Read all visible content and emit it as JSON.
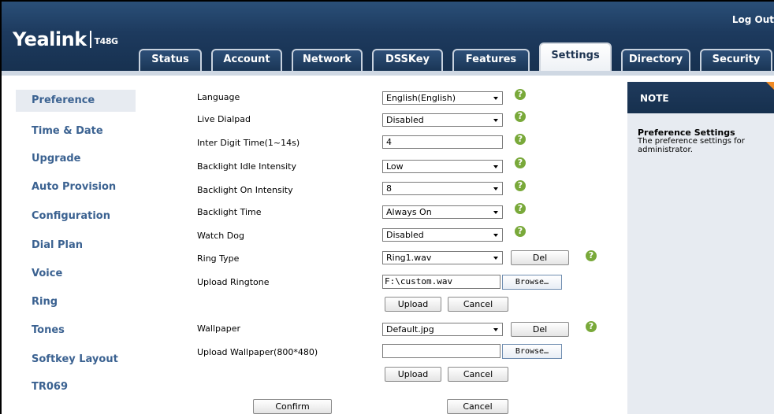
{
  "header": {
    "logo_brand": "Yealink",
    "logo_model": "T48G",
    "logout": "Log Out"
  },
  "tabs": [
    {
      "label": "Status"
    },
    {
      "label": "Account"
    },
    {
      "label": "Network"
    },
    {
      "label": "DSSKey"
    },
    {
      "label": "Features"
    },
    {
      "label": "Settings"
    },
    {
      "label": "Directory"
    },
    {
      "label": "Security"
    }
  ],
  "active_tab": "Settings",
  "sidebar": {
    "items": [
      {
        "label": "Preference"
      },
      {
        "label": "Time & Date"
      },
      {
        "label": "Upgrade"
      },
      {
        "label": "Auto Provision"
      },
      {
        "label": "Configuration"
      },
      {
        "label": "Dial Plan"
      },
      {
        "label": "Voice"
      },
      {
        "label": "Ring"
      },
      {
        "label": "Tones"
      },
      {
        "label": "Softkey Layout"
      },
      {
        "label": "TR069"
      }
    ],
    "active": "Preference"
  },
  "form": {
    "language": {
      "label": "Language",
      "value": "English(English)"
    },
    "live_dialpad": {
      "label": "Live Dialpad",
      "value": "Disabled"
    },
    "inter_digit": {
      "label": "Inter Digit Time(1~14s)",
      "value": "4"
    },
    "backlight_idle": {
      "label": "Backlight Idle Intensity",
      "value": "Low"
    },
    "backlight_on": {
      "label": "Backlight On Intensity",
      "value": "8"
    },
    "backlight_time": {
      "label": "Backlight Time",
      "value": "Always On"
    },
    "watch_dog": {
      "label": "Watch Dog",
      "value": "Disabled"
    },
    "ring_type": {
      "label": "Ring Type",
      "value": "Ring1.wav",
      "del": "Del"
    },
    "upload_ringtone": {
      "label": "Upload Ringtone",
      "file": "F:\\custom.wav",
      "browse": "Browse…",
      "upload": "Upload",
      "cancel": "Cancel"
    },
    "wallpaper": {
      "label": "Wallpaper",
      "value": "Default.jpg",
      "del": "Del"
    },
    "upload_wallpaper": {
      "label": "Upload Wallpaper(800*480)",
      "file": "",
      "browse": "Browse…",
      "upload": "Upload",
      "cancel": "Cancel"
    },
    "help_glyph": "?",
    "confirm": "Confirm",
    "cancel": "Cancel"
  },
  "note": {
    "header": "NOTE",
    "title": "Preference Settings",
    "text": "The preference settings for administrator."
  },
  "colors": {
    "header_bg": "#1d3a5e",
    "sidebar_text": "#3b6291",
    "help_icon": "#79a93a",
    "note_bg": "#e7ebf1",
    "accent_orange": "#f08a24"
  }
}
